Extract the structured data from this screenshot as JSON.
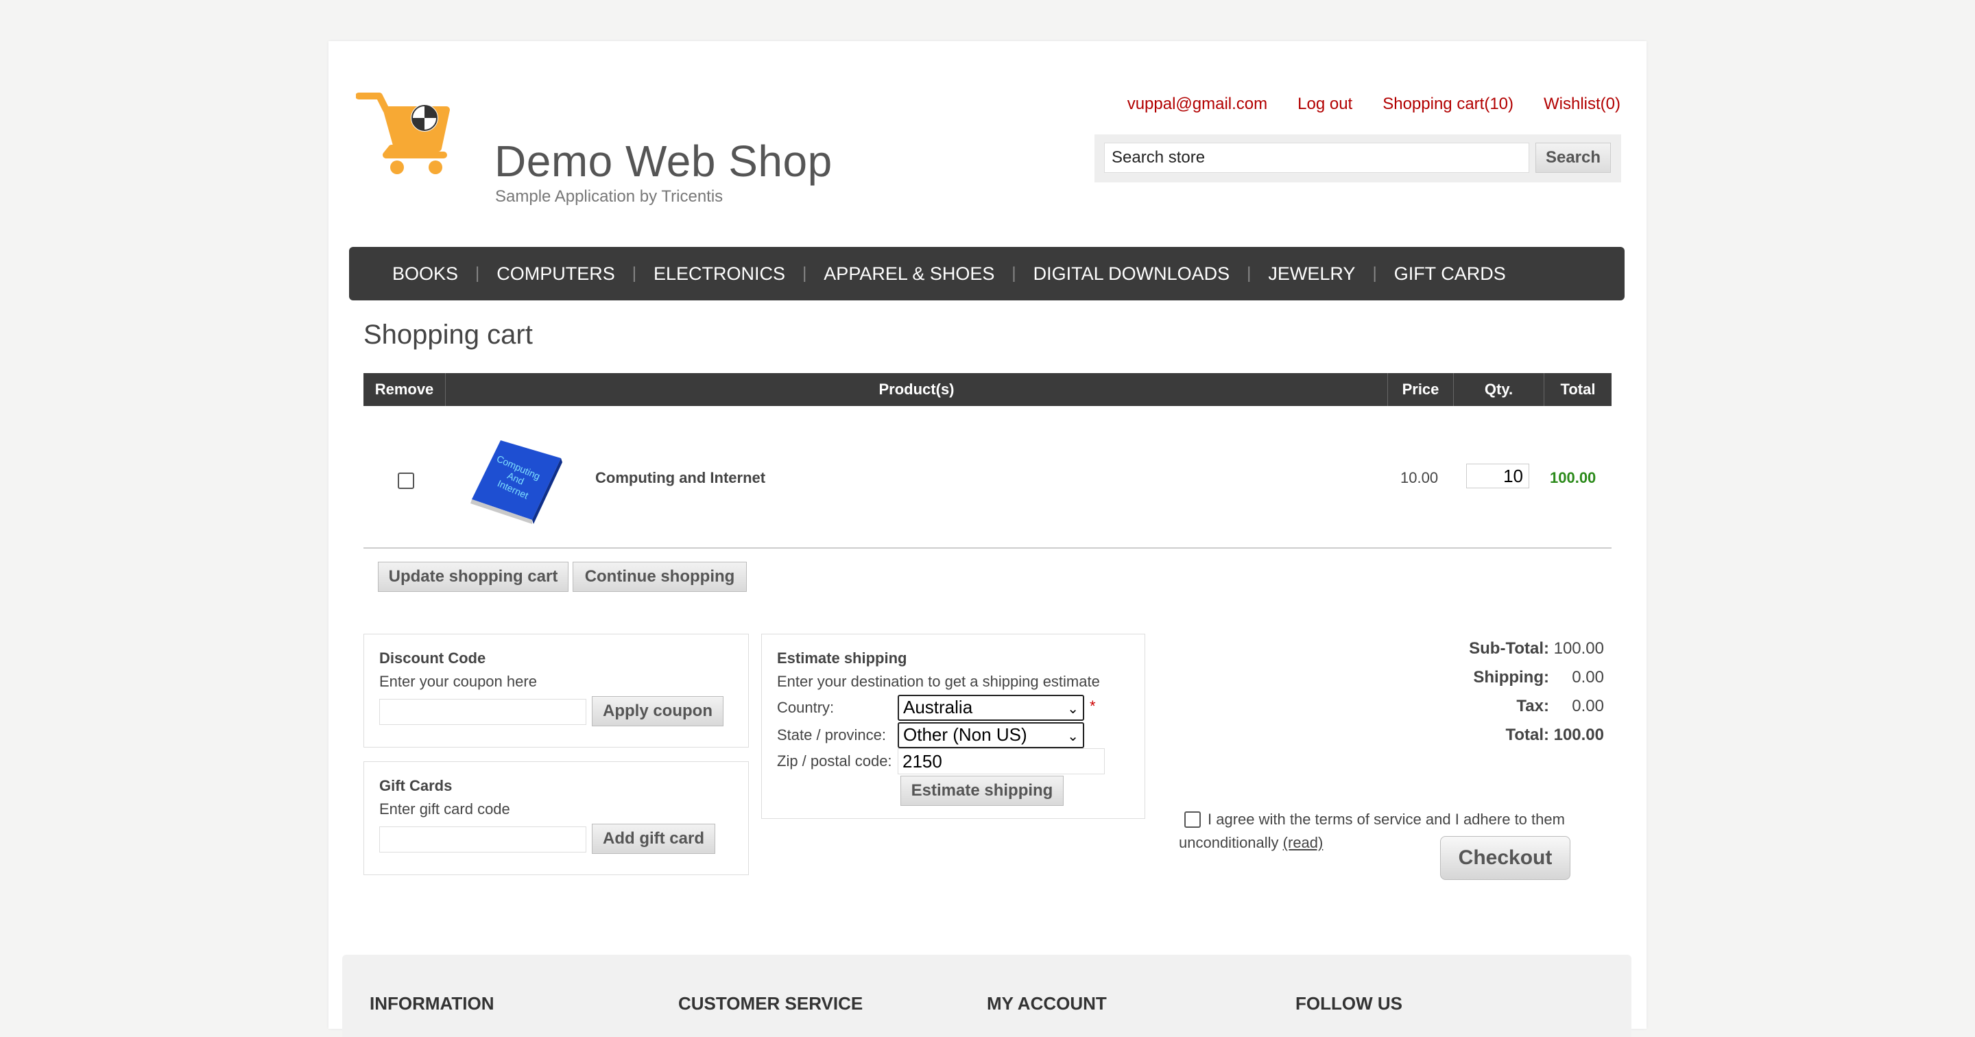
{
  "header": {
    "logo_title": "Demo Web Shop",
    "logo_subtitle": "Sample Application by Tricentis",
    "links": [
      "vuppal@gmail.com",
      "Log out",
      "Shopping cart(10)",
      "Wishlist(0)"
    ],
    "search_placeholder": "Search store",
    "search_value": "Search store",
    "search_button": "Search"
  },
  "menu": [
    "BOOKS",
    "COMPUTERS",
    "ELECTRONICS",
    "APPAREL & SHOES",
    "DIGITAL DOWNLOADS",
    "JEWELRY",
    "GIFT CARDS"
  ],
  "page": {
    "title": "Shopping cart"
  },
  "cart": {
    "headers": [
      "Remove",
      "Product(s)",
      "Price",
      "Qty.",
      "Total"
    ],
    "items": [
      {
        "image_text": "Computing And Internet",
        "name": "Computing and Internet",
        "price": "10.00",
        "qty": "10",
        "total": "100.00"
      }
    ],
    "update_button": "Update shopping cart",
    "continue_button": "Continue shopping"
  },
  "discount": {
    "title": "Discount Code",
    "hint": "Enter your coupon here",
    "button": "Apply coupon"
  },
  "giftcard": {
    "title": "Gift Cards",
    "hint": "Enter gift card code",
    "button": "Add gift card"
  },
  "shipping": {
    "title": "Estimate shipping",
    "hint": "Enter your destination to get a shipping estimate",
    "country_label": "Country:",
    "country_value": "Australia",
    "state_label": "State / province:",
    "state_value": "Other (Non US)",
    "zip_label": "Zip / postal code:",
    "zip_value": "2150",
    "required_mark": "*",
    "button": "Estimate shipping"
  },
  "totals": {
    "subtotal_label": "Sub-Total:",
    "subtotal": "100.00",
    "shipping_label": "Shipping:",
    "shipping": "0.00",
    "tax_label": "Tax:",
    "tax": "0.00",
    "total_label": "Total:",
    "total": "100.00"
  },
  "terms": {
    "text": "I agree with the terms of service and I adhere to them unconditionally",
    "read_link": "(read)"
  },
  "checkout_button": "Checkout",
  "footer": {
    "columns": [
      "INFORMATION",
      "CUSTOMER SERVICE",
      "MY ACCOUNT",
      "FOLLOW US"
    ]
  },
  "colors": {
    "accent_red": "#b20000",
    "menu_bg": "#3b3b3b",
    "total_green": "#2b8a1a",
    "logo_orange": "#f7a934"
  }
}
